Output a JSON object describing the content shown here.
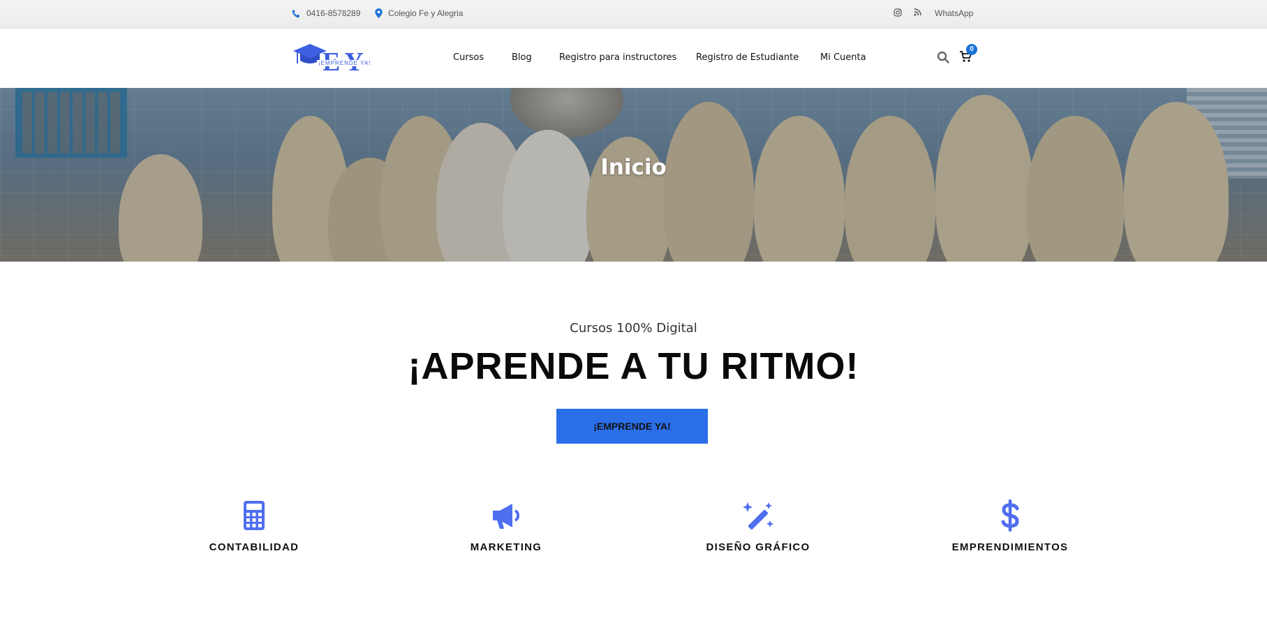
{
  "topbar": {
    "phone": "0416-8578289",
    "address": "Colegio Fe y Alegria",
    "social_icons": [
      "instagram-icon",
      "rss-icon"
    ],
    "whatsapp": "WhatsApp"
  },
  "header": {
    "logo_letters": "EY",
    "logo_tagline": "¡EMPRENDE YA!",
    "nav": [
      "Cursos",
      "Blog",
      "Registro para instructores",
      "Registro de Estudiante",
      "Mi Cuenta"
    ],
    "cart_count": "0",
    "icons": [
      "search-icon",
      "cart-icon"
    ]
  },
  "hero": {
    "title": "Inicio"
  },
  "main": {
    "kicker": "Cursos 100% Digital",
    "headline": "¡APRENDE A TU RITMO!",
    "cta": "¡EMPRENDE YA!"
  },
  "features": [
    {
      "label": "CONTABILIDAD",
      "icon": "calculator-icon"
    },
    {
      "label": "MARKETING",
      "icon": "megaphone-icon"
    },
    {
      "label": "DISEÑO GRÁFICO",
      "icon": "magic-wand-icon"
    },
    {
      "label": "EMPRENDIMIENTOS",
      "icon": "dollar-icon"
    }
  ],
  "colors": {
    "accent": "#2a6ee8",
    "icon_blue": "#4f6ef0",
    "badge": "#1d72d6"
  }
}
